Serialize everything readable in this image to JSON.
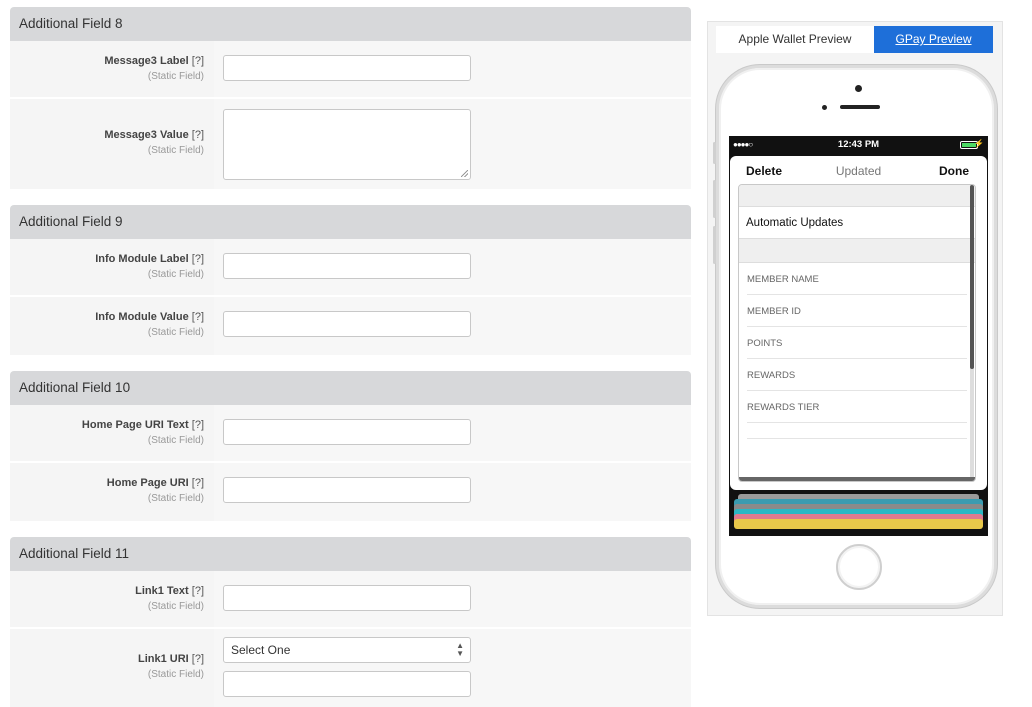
{
  "sections": [
    {
      "title": "Additional Field 8",
      "rows": [
        {
          "label": "Message3 Label",
          "help": "[?]",
          "note": "(Static Field)",
          "type": "text"
        },
        {
          "label": "Message3 Value",
          "help": "[?]",
          "note": "(Static Field)",
          "type": "textarea"
        }
      ]
    },
    {
      "title": "Additional Field 9",
      "rows": [
        {
          "label": "Info Module Label",
          "help": "[?]",
          "note": "(Static Field)",
          "type": "text"
        },
        {
          "label": "Info Module Value",
          "help": "[?]",
          "note": "(Static Field)",
          "type": "text"
        }
      ]
    },
    {
      "title": "Additional Field 10",
      "rows": [
        {
          "label": "Home Page URI Text",
          "help": "[?]",
          "note": "(Static Field)",
          "type": "text"
        },
        {
          "label": "Home Page URI",
          "help": "[?]",
          "note": "(Static Field)",
          "type": "text"
        }
      ]
    },
    {
      "title": "Additional Field 11",
      "rows": [
        {
          "label": "Link1 Text",
          "help": "[?]",
          "note": "(Static Field)",
          "type": "text"
        },
        {
          "label": "Link1 URI",
          "help": "[?]",
          "note": "(Static Field)",
          "type": "select-text",
          "select_value": "Select One"
        }
      ]
    }
  ],
  "preview": {
    "tabs": [
      {
        "label": "Apple Wallet Preview",
        "active": false
      },
      {
        "label": "GPay Preview",
        "active": true
      }
    ],
    "status_time": "12:43 PM",
    "signal_dots": "●●●●○",
    "bolt": "⚡",
    "sheet": {
      "delete_label": "Delete",
      "updated_label": "Updated",
      "done_label": "Done",
      "automatic_updates": "Automatic Updates",
      "fields": [
        "MEMBER NAME",
        "MEMBER ID",
        "POINTS",
        "REWARDS",
        "REWARDS TIER"
      ]
    },
    "colors": {
      "tab_active": "#1e6fd9",
      "battery": "#4cd964",
      "card_stack": [
        "#9a9a9a",
        "#3a9bb0",
        "#8a8a8a",
        "#2bb7c4",
        "#e07a8e",
        "#e8c84a"
      ]
    }
  }
}
